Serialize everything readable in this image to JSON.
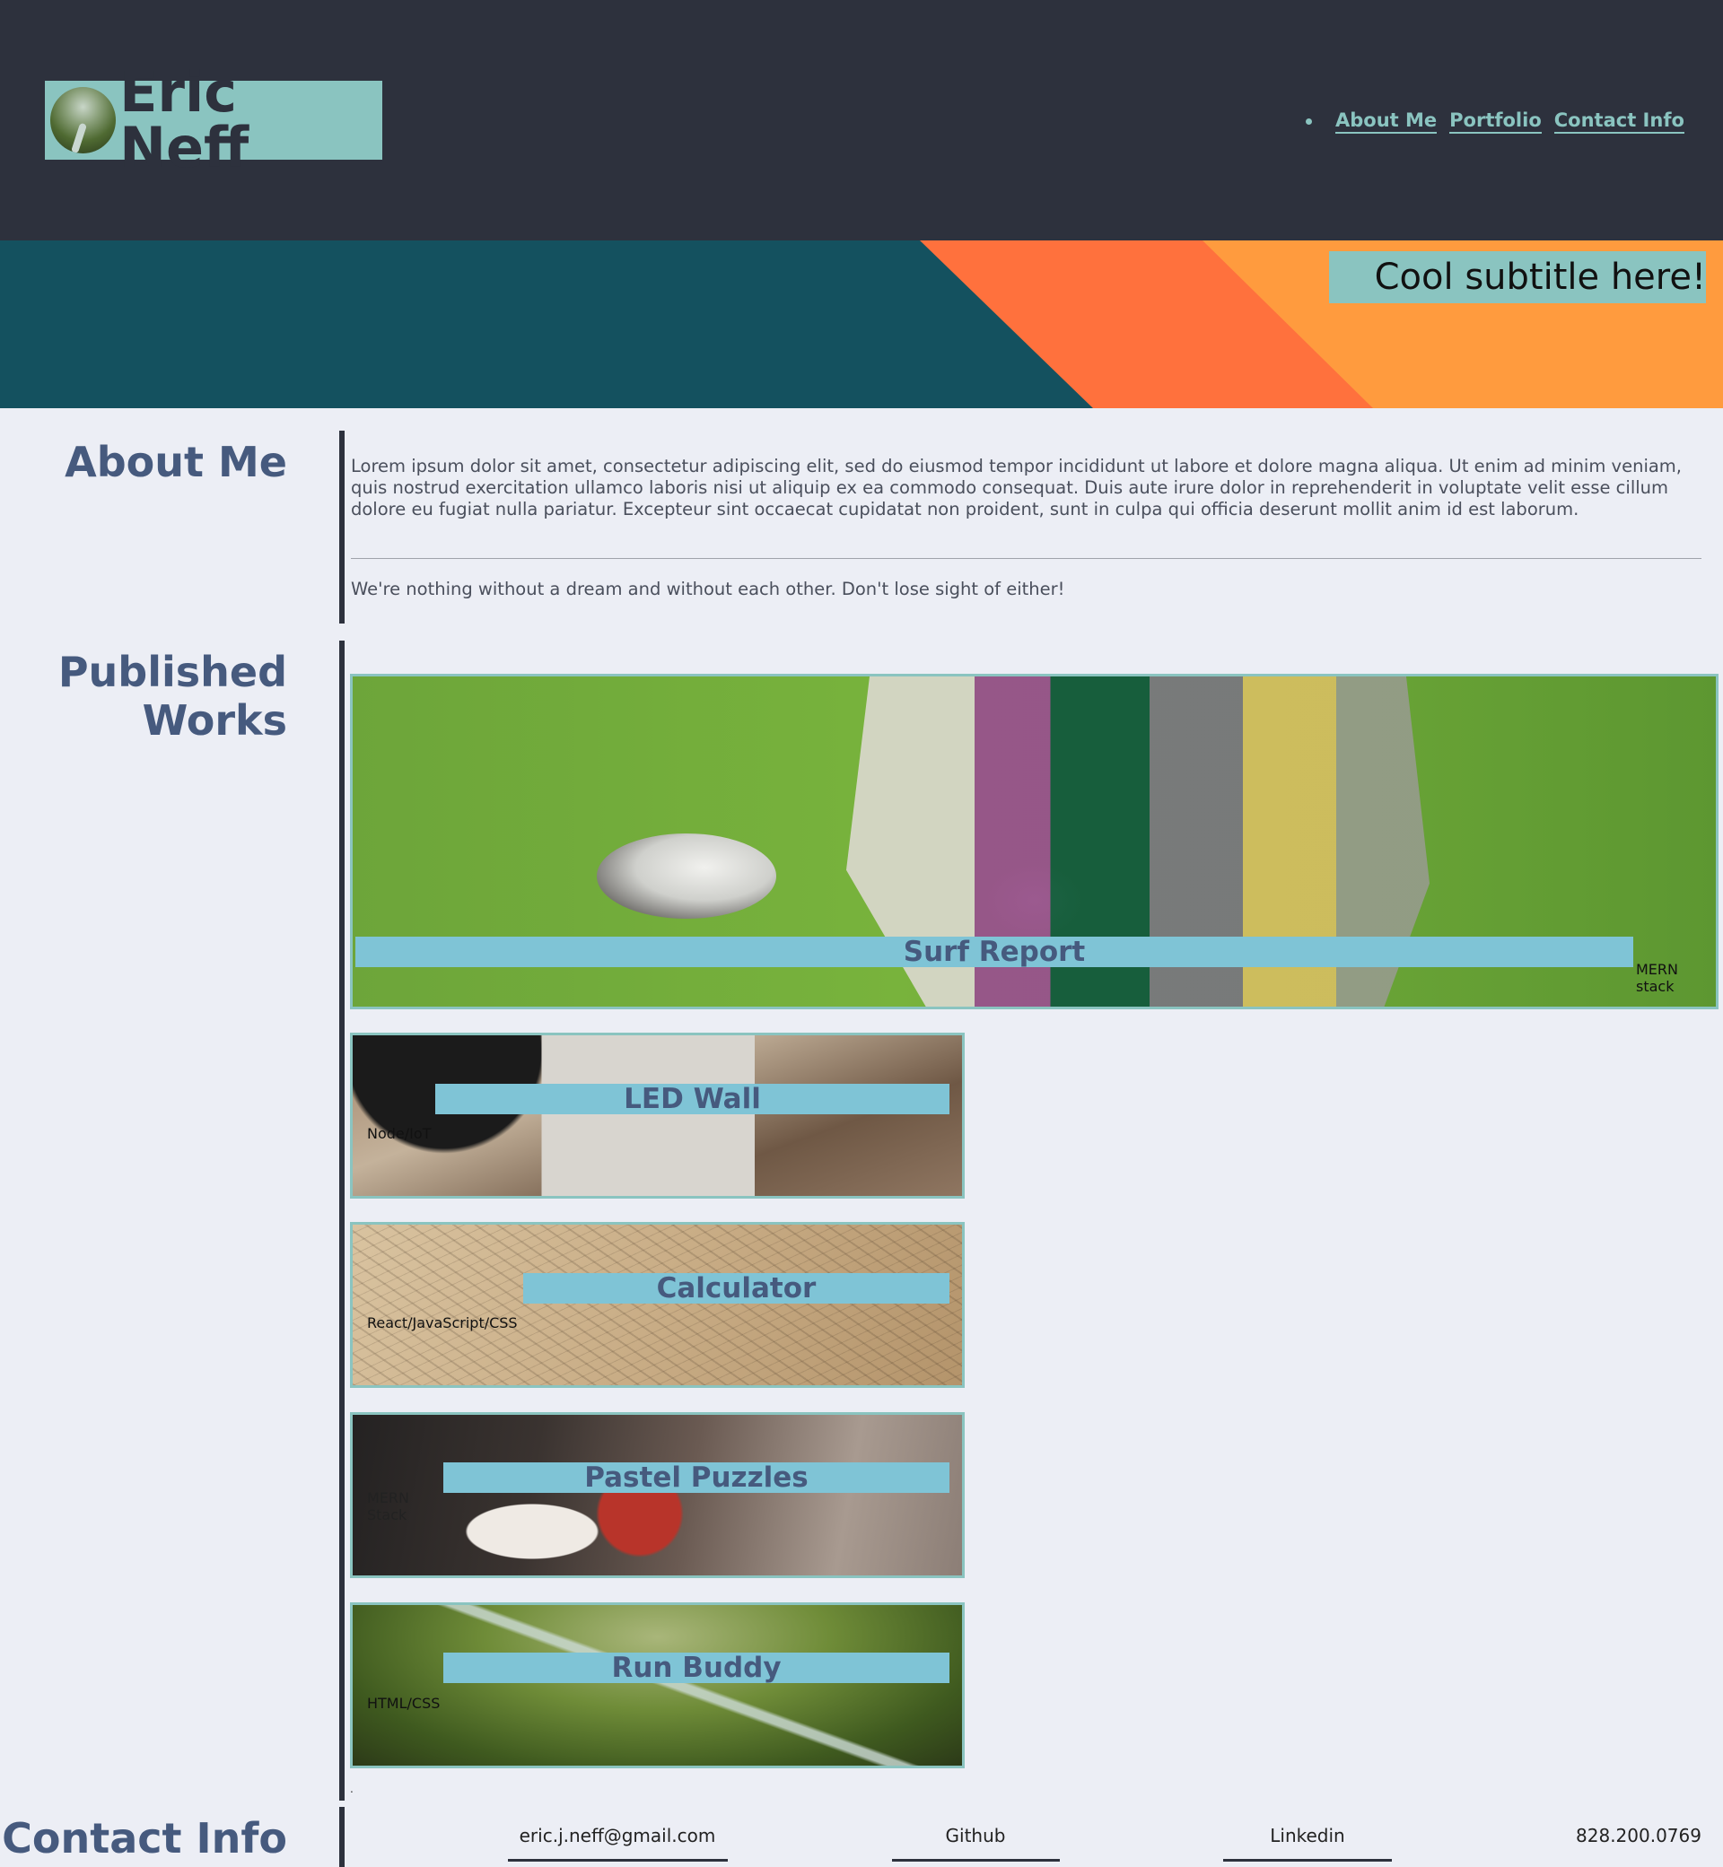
{
  "header": {
    "brand_name": "Eric Neff",
    "avatar_icon": "landscape-avatar-icon",
    "nav": [
      {
        "label": "About Me"
      },
      {
        "label": "Portfolio"
      },
      {
        "label": "Contact Info"
      }
    ]
  },
  "hero": {
    "subtitle": "Cool subtitle here!"
  },
  "about": {
    "heading": "About Me",
    "paragraph": "Lorem ipsum dolor sit amet, consectetur adipiscing elit, sed do eiusmod tempor incididunt ut labore et dolore magna aliqua. Ut enim ad minim veniam, quis nostrud exercitation ullamco laboris nisi ut aliquip ex ea commodo consequat. Duis aute irure dolor in reprehenderit in voluptate velit esse cillum dolore eu fugiat nulla pariatur. Excepteur sint occaecat cupidatat non proident, sunt in culpa qui officia deserunt mollit anim id est laborum.",
    "quote": "We're nothing without a dream and without each other. Don't lose sight of either!"
  },
  "works": {
    "heading_line1": "Published",
    "heading_line2": "Works",
    "items": [
      {
        "title": "Surf Report",
        "tech_line1": "MERN",
        "tech_line2": "stack"
      },
      {
        "title": "LED Wall",
        "tech": "Node/IoT"
      },
      {
        "title": "Calculator",
        "tech": "React/JavaScript/CSS"
      },
      {
        "title": "Pastel Puzzles",
        "tech_line1": "MERN",
        "tech_line2": "Stack"
      },
      {
        "title": "Run Buddy",
        "tech": "HTML/CSS"
      }
    ],
    "trailing_mark": "."
  },
  "contact": {
    "heading": "Contact Info",
    "email": "eric.j.neff@gmail.com",
    "github": "Github",
    "linkedin": "Linkedin",
    "phone": "828.200.0769"
  },
  "colors": {
    "header_bg": "#2d313d",
    "accent_teal": "#8ac4c0",
    "hero_dark": "#14515f",
    "hero_orange": "#ff713d",
    "hero_light_orange": "#ff9b3e",
    "heading_blue": "#465a7e",
    "title_bar": "#7fc4d6",
    "page_bg": "#eceef5"
  }
}
